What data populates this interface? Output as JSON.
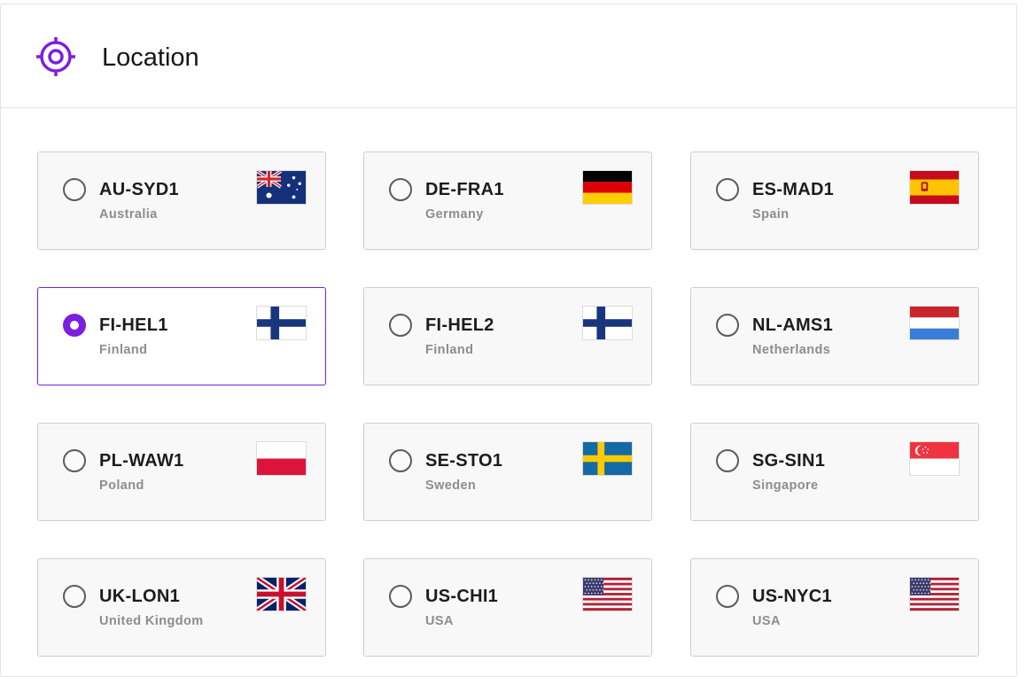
{
  "header": {
    "title": "Location",
    "icon": "location-target-icon",
    "accent": "#7b1fe0"
  },
  "locations": [
    {
      "code": "AU-SYD1",
      "country": "Australia",
      "flag": "australia-flag-icon",
      "selected": false
    },
    {
      "code": "DE-FRA1",
      "country": "Germany",
      "flag": "germany-flag-icon",
      "selected": false
    },
    {
      "code": "ES-MAD1",
      "country": "Spain",
      "flag": "spain-flag-icon",
      "selected": false
    },
    {
      "code": "FI-HEL1",
      "country": "Finland",
      "flag": "finland-flag-icon",
      "selected": true
    },
    {
      "code": "FI-HEL2",
      "country": "Finland",
      "flag": "finland-flag-icon",
      "selected": false
    },
    {
      "code": "NL-AMS1",
      "country": "Netherlands",
      "flag": "netherlands-flag-icon",
      "selected": false
    },
    {
      "code": "PL-WAW1",
      "country": "Poland",
      "flag": "poland-flag-icon",
      "selected": false
    },
    {
      "code": "SE-STO1",
      "country": "Sweden",
      "flag": "sweden-flag-icon",
      "selected": false
    },
    {
      "code": "SG-SIN1",
      "country": "Singapore",
      "flag": "singapore-flag-icon",
      "selected": false
    },
    {
      "code": "UK-LON1",
      "country": "United Kingdom",
      "flag": "uk-flag-icon",
      "selected": false
    },
    {
      "code": "US-CHI1",
      "country": "USA",
      "flag": "usa-flag-icon",
      "selected": false
    },
    {
      "code": "US-NYC1",
      "country": "USA",
      "flag": "usa-flag-icon",
      "selected": false
    }
  ]
}
